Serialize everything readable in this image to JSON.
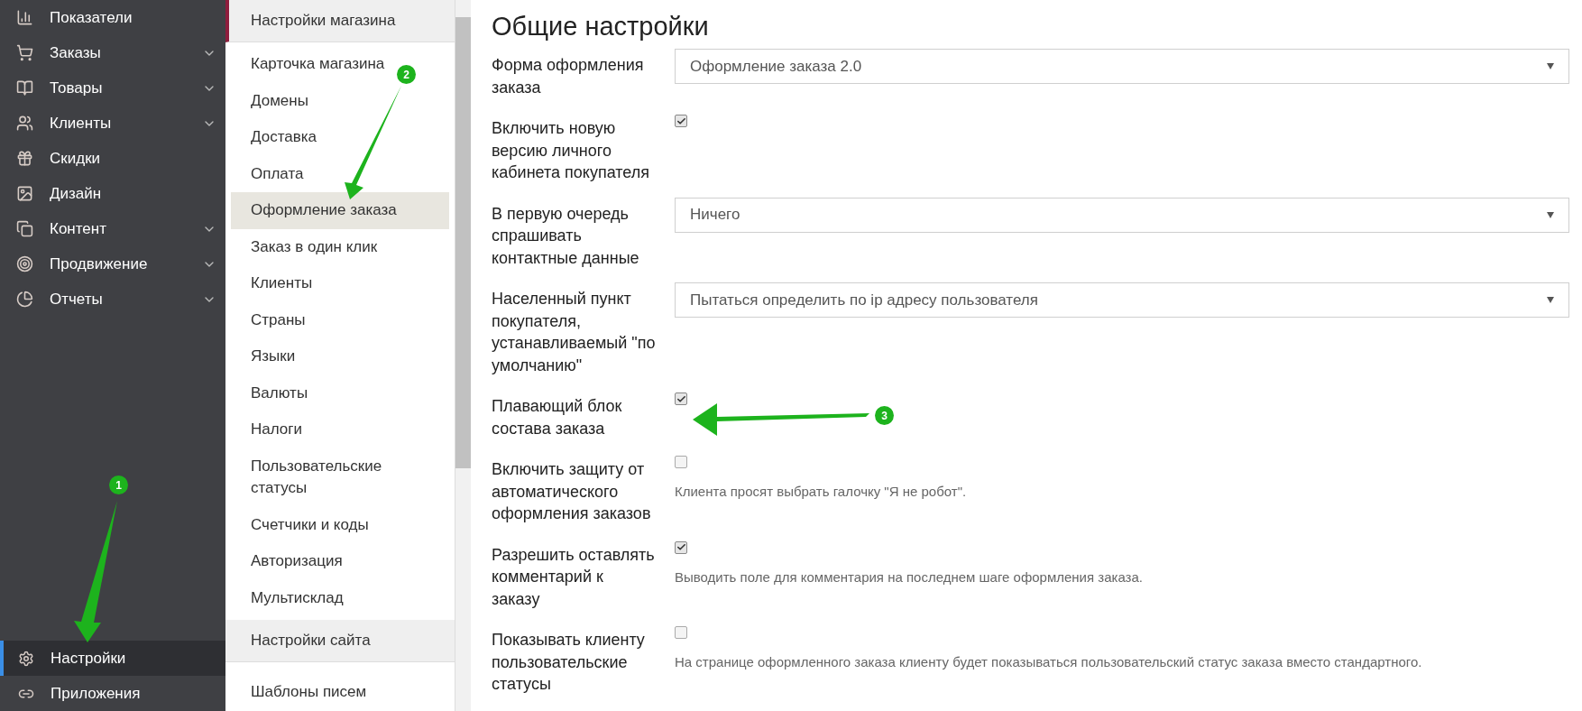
{
  "sidebar": {
    "items": [
      {
        "label": "Показатели",
        "expandable": false,
        "selected": false
      },
      {
        "label": "Заказы",
        "expandable": true,
        "selected": false
      },
      {
        "label": "Товары",
        "expandable": true,
        "selected": false
      },
      {
        "label": "Клиенты",
        "expandable": true,
        "selected": false
      },
      {
        "label": "Скидки",
        "expandable": false,
        "selected": false
      },
      {
        "label": "Дизайн",
        "expandable": false,
        "selected": false
      },
      {
        "label": "Контент",
        "expandable": true,
        "selected": false
      },
      {
        "label": "Продвижение",
        "expandable": true,
        "selected": false
      },
      {
        "label": "Отчеты",
        "expandable": true,
        "selected": false
      }
    ],
    "bottom_items": [
      {
        "label": "Настройки",
        "selected": true
      },
      {
        "label": "Приложения",
        "selected": false
      }
    ]
  },
  "submenu": {
    "sections": [
      {
        "title": "Настройки магазина",
        "items": [
          {
            "label": "Карточка магазина",
            "selected": false
          },
          {
            "label": "Домены",
            "selected": false
          },
          {
            "label": "Доставка",
            "selected": false
          },
          {
            "label": "Оплата",
            "selected": false
          },
          {
            "label": "Оформление заказа",
            "selected": true
          },
          {
            "label": "Заказ в один клик",
            "selected": false
          },
          {
            "label": "Клиенты",
            "selected": false
          },
          {
            "label": "Страны",
            "selected": false
          },
          {
            "label": "Языки",
            "selected": false
          },
          {
            "label": "Валюты",
            "selected": false
          },
          {
            "label": "Налоги",
            "selected": false
          },
          {
            "label": "Пользовательские статусы",
            "selected": false
          },
          {
            "label": "Счетчики и коды",
            "selected": false
          },
          {
            "label": "Авторизация",
            "selected": false
          },
          {
            "label": "Мультисклад",
            "selected": false
          }
        ]
      },
      {
        "title": "Настройки сайта"
      }
    ],
    "cut_item": "Шаблоны писем"
  },
  "main": {
    "title": "Общие настройки",
    "settings": [
      {
        "kind": "select",
        "label": "Форма оформления заказа",
        "value": "Оформление заказа 2.0"
      },
      {
        "kind": "checkbox",
        "label": "Включить новую версию личного кабинета покупателя",
        "checked": true
      },
      {
        "kind": "select",
        "label": "В первую очередь спрашивать контактные данные",
        "value": "Ничего"
      },
      {
        "kind": "select",
        "label": "Населенный пункт покупателя, устанавливаемый \"по умолчанию\"",
        "value": "Пытаться определить по ip адресу пользователя"
      },
      {
        "kind": "checkbox",
        "label": "Плавающий блок состава заказа",
        "checked": true
      },
      {
        "kind": "checkbox",
        "label": "Включить защиту от автоматического оформления заказов",
        "checked": false,
        "hint": "Клиента просят выбрать галочку \"Я не робот\"."
      },
      {
        "kind": "checkbox",
        "label": "Разрешить оставлять комментарий к заказу",
        "checked": true,
        "hint": "Выводить поле для комментария на последнем шаге оформления заказа."
      },
      {
        "kind": "checkbox",
        "label": "Показывать клиенту пользовательские статусы",
        "checked": false,
        "hint": "На странице оформленного заказа клиенту будет показываться пользовательский статус заказа вместо стандартного."
      }
    ]
  },
  "annotations": [
    {
      "number": "1"
    },
    {
      "number": "2"
    },
    {
      "number": "3"
    }
  ]
}
